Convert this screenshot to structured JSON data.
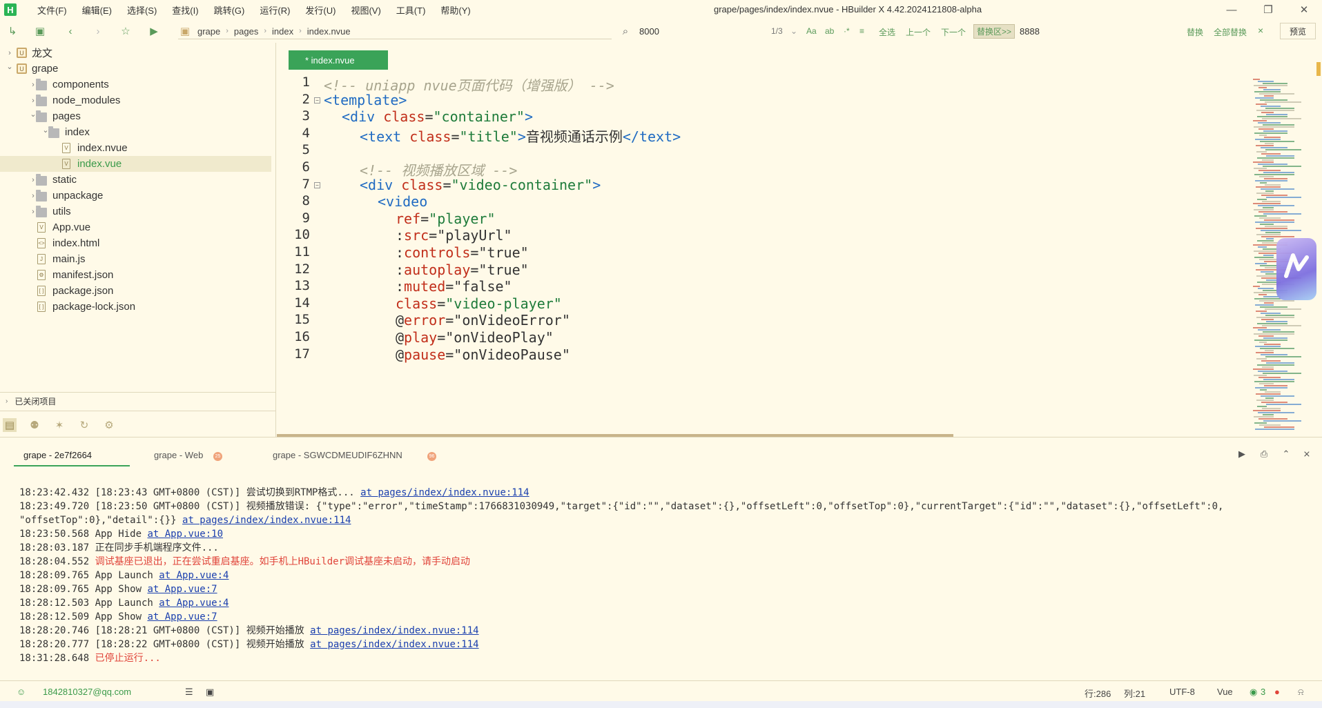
{
  "window": {
    "title": "grape/pages/index/index.nvue - HBuilder X 4.42.2024121808-alpha",
    "logo": "H"
  },
  "menu": [
    "文件(F)",
    "编辑(E)",
    "选择(S)",
    "查找(I)",
    "跳转(G)",
    "运行(R)",
    "发行(U)",
    "视图(V)",
    "工具(T)",
    "帮助(Y)"
  ],
  "breadcrumb": [
    "grape",
    "pages",
    "index",
    "index.nvue"
  ],
  "find": {
    "value": "8000",
    "count": "1/3",
    "options": [
      "Aa",
      "ab",
      "·*"
    ],
    "select_all": "全选",
    "prev": "上一个",
    "next": "下一个",
    "replace_toggle": "替换区>>",
    "replace_value": "8888",
    "replace": "替换",
    "replace_all": "全部替换",
    "close": "×"
  },
  "preview_label": "预览",
  "tree": [
    {
      "label": "龙文",
      "type": "project",
      "expanded": false,
      "depth": 0
    },
    {
      "label": "grape",
      "type": "project",
      "expanded": true,
      "depth": 0
    },
    {
      "label": "components",
      "type": "folder",
      "expanded": false,
      "depth": 1
    },
    {
      "label": "node_modules",
      "type": "folder",
      "expanded": false,
      "depth": 1
    },
    {
      "label": "pages",
      "type": "folder",
      "expanded": true,
      "depth": 1
    },
    {
      "label": "index",
      "type": "folder",
      "expanded": true,
      "depth": 2
    },
    {
      "label": "index.nvue",
      "type": "file-v",
      "depth": 3
    },
    {
      "label": "index.vue",
      "type": "file-v",
      "depth": 3,
      "selected": true
    },
    {
      "label": "static",
      "type": "folder",
      "expanded": false,
      "depth": 1
    },
    {
      "label": "unpackage",
      "type": "folder",
      "expanded": false,
      "depth": 1
    },
    {
      "label": "utils",
      "type": "folder",
      "expanded": false,
      "depth": 1
    },
    {
      "label": "App.vue",
      "type": "file-v",
      "depth": 1
    },
    {
      "label": "index.html",
      "type": "file-html",
      "depth": 1
    },
    {
      "label": "main.js",
      "type": "file-js",
      "depth": 1
    },
    {
      "label": "manifest.json",
      "type": "file-gear",
      "depth": 1
    },
    {
      "label": "package.json",
      "type": "file-json",
      "depth": 1
    },
    {
      "label": "package-lock.json",
      "type": "file-json",
      "depth": 1
    }
  ],
  "closed_projects": "已关闭项目",
  "editor": {
    "tab_label": "* index.nvue",
    "lines": [
      {
        "n": "1",
        "fold": false,
        "indent": 0,
        "parts": [
          [
            "c-comment",
            "<!-- uniapp nvue页面代码（增强版） -->"
          ]
        ]
      },
      {
        "n": "2",
        "fold": true,
        "indent": 0,
        "parts": [
          [
            "c-tag",
            "<template>"
          ]
        ]
      },
      {
        "n": "3",
        "fold": false,
        "indent": 1,
        "parts": [
          [
            "c-tag",
            "<div "
          ],
          [
            "c-attr",
            "class"
          ],
          [
            "c-text",
            "="
          ],
          [
            "c-str",
            "\"container\""
          ],
          [
            "c-tag",
            ">"
          ]
        ]
      },
      {
        "n": "4",
        "fold": false,
        "indent": 2,
        "parts": [
          [
            "c-tag",
            "<text "
          ],
          [
            "c-attr",
            "class"
          ],
          [
            "c-text",
            "="
          ],
          [
            "c-str",
            "\"title\""
          ],
          [
            "c-tag",
            ">"
          ],
          [
            "c-text",
            "音视频通话示例"
          ],
          [
            "c-tag",
            "</text>"
          ]
        ]
      },
      {
        "n": "5",
        "fold": false,
        "indent": 0,
        "parts": []
      },
      {
        "n": "6",
        "fold": false,
        "indent": 2,
        "parts": [
          [
            "c-comment",
            "<!-- 视频播放区域 -->"
          ]
        ]
      },
      {
        "n": "7",
        "fold": true,
        "indent": 2,
        "parts": [
          [
            "c-tag",
            "<div "
          ],
          [
            "c-attr",
            "class"
          ],
          [
            "c-text",
            "="
          ],
          [
            "c-str",
            "\"video-container\""
          ],
          [
            "c-tag",
            ">"
          ]
        ]
      },
      {
        "n": "8",
        "fold": false,
        "indent": 3,
        "parts": [
          [
            "c-tag",
            "<video"
          ]
        ]
      },
      {
        "n": "9",
        "fold": false,
        "indent": 4,
        "parts": [
          [
            "c-attr",
            "ref"
          ],
          [
            "c-text",
            "="
          ],
          [
            "c-str",
            "\"player\""
          ]
        ]
      },
      {
        "n": "10",
        "fold": false,
        "indent": 4,
        "parts": [
          [
            "c-text",
            ":"
          ],
          [
            "c-attr",
            "src"
          ],
          [
            "c-text",
            "=\"playUrl\""
          ]
        ]
      },
      {
        "n": "11",
        "fold": false,
        "indent": 4,
        "parts": [
          [
            "c-text",
            ":"
          ],
          [
            "c-attr",
            "controls"
          ],
          [
            "c-text",
            "=\"true\""
          ]
        ]
      },
      {
        "n": "12",
        "fold": false,
        "indent": 4,
        "parts": [
          [
            "c-text",
            ":"
          ],
          [
            "c-attr",
            "autoplay"
          ],
          [
            "c-text",
            "=\"true\""
          ]
        ]
      },
      {
        "n": "13",
        "fold": false,
        "indent": 4,
        "parts": [
          [
            "c-text",
            ":"
          ],
          [
            "c-attr",
            "muted"
          ],
          [
            "c-text",
            "=\"false\""
          ]
        ]
      },
      {
        "n": "14",
        "fold": false,
        "indent": 4,
        "parts": [
          [
            "c-attr",
            "class"
          ],
          [
            "c-text",
            "="
          ],
          [
            "c-str",
            "\"video-player\""
          ]
        ]
      },
      {
        "n": "15",
        "fold": false,
        "indent": 4,
        "parts": [
          [
            "c-text",
            "@"
          ],
          [
            "c-attr",
            "error"
          ],
          [
            "c-text",
            "=\"onVideoError\""
          ]
        ]
      },
      {
        "n": "16",
        "fold": false,
        "indent": 4,
        "parts": [
          [
            "c-text",
            "@"
          ],
          [
            "c-attr",
            "play"
          ],
          [
            "c-text",
            "=\"onVideoPlay\""
          ]
        ]
      },
      {
        "n": "17",
        "fold": false,
        "indent": 4,
        "parts": [
          [
            "c-text",
            "@"
          ],
          [
            "c-attr",
            "pause"
          ],
          [
            "c-text",
            "=\"onVideoPause\""
          ]
        ]
      }
    ]
  },
  "console": {
    "tabs": [
      {
        "label": "grape - 2e7f2664",
        "active": true
      },
      {
        "label": "grape - Web",
        "badge": "25"
      },
      {
        "label": "grape - SGWCDMEUDIF6ZHNN",
        "badge": "96"
      }
    ],
    "log": [
      [
        [
          "t",
          "18:23:42.432 [18:23:43 GMT+0800 (CST)] 尝试切换到RTMP格式... "
        ],
        [
          "l",
          "at pages/index/index.nvue:114"
        ]
      ],
      [
        [
          "t",
          "18:23:49.720 [18:23:50 GMT+0800 (CST)] 视频播放错误: {\"type\":\"error\",\"timeStamp\":1766831030949,\"target\":{\"id\":\"\",\"dataset\":{},\"offsetLeft\":0,\"offsetTop\":0},\"currentTarget\":{\"id\":\"\",\"dataset\":{},\"offsetLeft\":0,"
        ]
      ],
      [
        [
          "t",
          "\"offsetTop\":0},\"detail\":{}} "
        ],
        [
          "l",
          "at pages/index/index.nvue:114"
        ]
      ],
      [
        [
          "t",
          "18:23:50.568 App Hide "
        ],
        [
          "l",
          "at App.vue:10"
        ]
      ],
      [
        [
          "t",
          "18:28:03.187 正在同步手机端程序文件..."
        ]
      ],
      [
        [
          "t",
          "18:28:04.552 "
        ],
        [
          "r",
          "调试基座已退出，正在尝试重启基座。如手机上HBuilder调试基座未启动，请手动启动"
        ]
      ],
      [
        [
          "t",
          "18:28:09.765 App Launch "
        ],
        [
          "l",
          "at App.vue:4"
        ]
      ],
      [
        [
          "t",
          "18:28:09.765 App Show "
        ],
        [
          "l",
          "at App.vue:7"
        ]
      ],
      [
        [
          "t",
          "18:28:12.503 App Launch "
        ],
        [
          "l",
          "at App.vue:4"
        ]
      ],
      [
        [
          "t",
          "18:28:12.509 App Show "
        ],
        [
          "l",
          "at App.vue:7"
        ]
      ],
      [
        [
          "t",
          "18:28:20.746 [18:28:21 GMT+0800 (CST)] 视频开始播放 "
        ],
        [
          "l",
          "at pages/index/index.nvue:114"
        ]
      ],
      [
        [
          "t",
          "18:28:20.777 [18:28:22 GMT+0800 (CST)] 视频开始播放 "
        ],
        [
          "l",
          "at pages/index/index.nvue:114"
        ]
      ],
      [
        [
          "t",
          "18:31:28.648 "
        ],
        [
          "r",
          "已停止运行..."
        ]
      ]
    ]
  },
  "status": {
    "user": "1842810327@qq.com",
    "row": "行:286",
    "col": "列:21",
    "encoding": "UTF-8",
    "language": "Vue",
    "notify_count": "3"
  }
}
